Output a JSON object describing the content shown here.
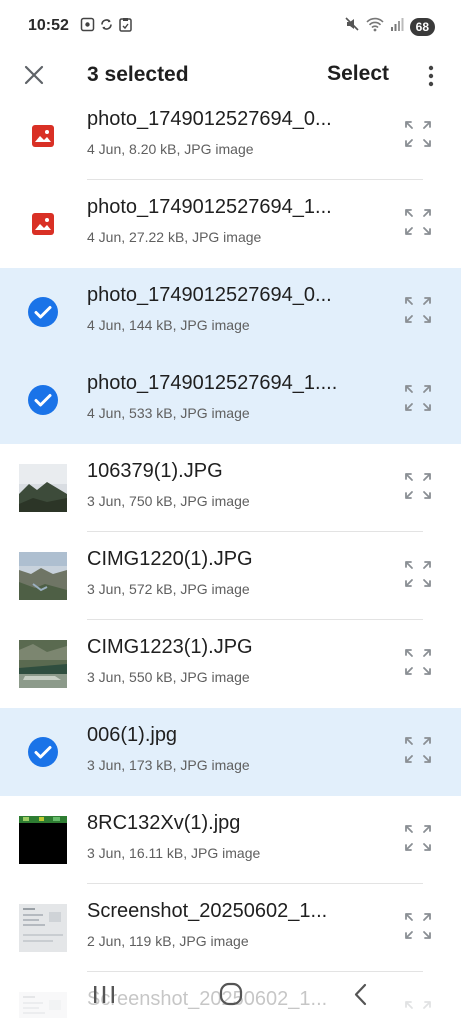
{
  "status_bar": {
    "time": "10:52",
    "battery": "68",
    "left_icons": [
      "screenshot-icon",
      "sync-icon",
      "clipboard-icon"
    ],
    "right_icons": [
      "mute-icon",
      "wifi-icon",
      "signal-icon",
      "battery-icon"
    ]
  },
  "app_bar": {
    "close_icon": "close-icon",
    "title": "3 selected",
    "select_label": "Select",
    "more_icon": "more-vert-icon"
  },
  "colors": {
    "selected_row": "#e2effb",
    "check_blue": "#1a73e8",
    "image_red": "#d93025"
  },
  "files": [
    {
      "name": "photo_1749012527694_0...",
      "meta": "4 Jun, 8.20 kB, JPG image",
      "selected": false,
      "thumb": "image-placeholder-icon"
    },
    {
      "name": "photo_1749012527694_1...",
      "meta": "4 Jun, 27.22 kB, JPG image",
      "selected": false,
      "thumb": "image-placeholder-icon"
    },
    {
      "name": "photo_1749012527694_0...",
      "meta": "4 Jun, 144 kB, JPG image",
      "selected": true,
      "thumb": "check-circle-icon"
    },
    {
      "name": "photo_1749012527694_1....",
      "meta": "4 Jun, 533 kB, JPG image",
      "selected": true,
      "thumb": "check-circle-icon"
    },
    {
      "name": "106379(1).JPG",
      "meta": "3 Jun, 750 kB, JPG image",
      "selected": false,
      "thumb": "mountain-photo-thumbnail"
    },
    {
      "name": "CIMG1220(1).JPG",
      "meta": "3 Jun, 572 kB, JPG image",
      "selected": false,
      "thumb": "valley-photo-thumbnail"
    },
    {
      "name": "CIMG1223(1).JPG",
      "meta": "3 Jun, 550 kB, JPG image",
      "selected": false,
      "thumb": "river-photo-thumbnail"
    },
    {
      "name": "006(1).jpg",
      "meta": "3 Jun, 173 kB, JPG image",
      "selected": true,
      "thumb": "check-circle-icon"
    },
    {
      "name": "8RC132Xv(1).jpg",
      "meta": "3 Jun, 16.11 kB, JPG image",
      "selected": false,
      "thumb": "black-image-thumbnail"
    },
    {
      "name": "Screenshot_20250602_1...",
      "meta": "2 Jun, 119 kB, JPG image",
      "selected": false,
      "thumb": "screenshot-thumbnail"
    },
    {
      "name": "Screenshot_20250602_1...",
      "meta": "",
      "selected": false,
      "thumb": "screenshot-thumbnail"
    }
  ],
  "nav_bar": {
    "recents_icon": "recents-icon",
    "home_icon": "home-icon",
    "back_icon": "back-icon"
  }
}
